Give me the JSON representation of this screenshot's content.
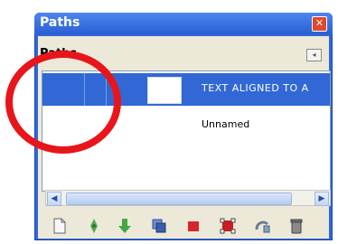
{
  "window": {
    "title": "Paths",
    "close_label": "✕"
  },
  "panel": {
    "label": "Paths",
    "menu_button": "◂"
  },
  "paths_list": [
    {
      "label": "TEXT ALIGNED TO A",
      "selected": true
    },
    {
      "label": "Unnamed",
      "selected": false
    }
  ],
  "scrollbar": {
    "left_arrow": "◀",
    "right_arrow": "▶"
  },
  "toolbar": {
    "buttons": [
      {
        "name": "new-path-icon",
        "color": "#f0f0f0"
      },
      {
        "name": "duplicate-path-icon",
        "color": "#5aa65a"
      },
      {
        "name": "move-down-icon",
        "color": "#43a843"
      },
      {
        "name": "selection-to-path-icon",
        "color": "#3a5ea8"
      },
      {
        "name": "fill-path-icon",
        "color": "#d8252c"
      },
      {
        "name": "stroke-path-icon",
        "color": "#c81e22"
      },
      {
        "name": "path-to-selection-icon",
        "color": "#6b7d96"
      },
      {
        "name": "delete-path-icon",
        "color": "#7a7a7a"
      }
    ]
  },
  "colors": {
    "title_bar": "#2f67d9",
    "selection": "#3168d5",
    "annotation_circle": "#e8151b"
  }
}
